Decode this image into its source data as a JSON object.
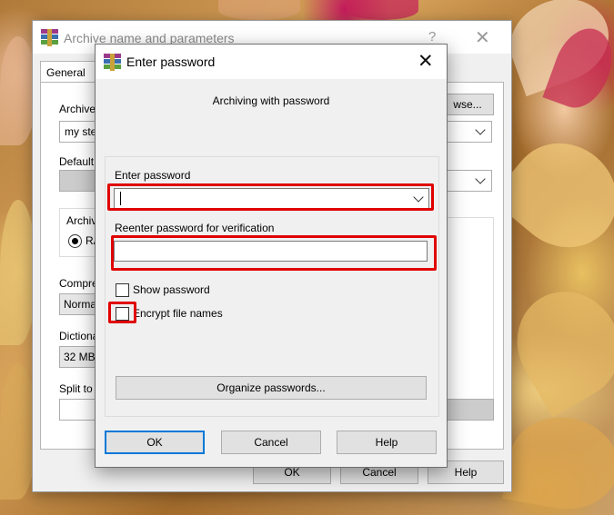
{
  "back_window": {
    "title": "Archive name and parameters",
    "help_glyph": "?",
    "close_glyph": "✕",
    "tab_general": "General",
    "archive_label_partial": "Archive",
    "archive_value_partial": "my ste",
    "browse_partial": "wse...",
    "default_label_partial": "Default",
    "archive_format_label_partial": "Archiv",
    "rar_label_partial": "RA",
    "compression_label_partial": "Compre",
    "compression_value_partial": "Norma",
    "dictionary_label_partial": "Dictiona",
    "dictionary_value_partial": "32 MB",
    "split_label_partial": "Split to",
    "ok_label": "OK",
    "cancel_label": "Cancel",
    "help_label": "Help"
  },
  "dialog": {
    "title": "Enter password",
    "close_glyph": "✕",
    "subtitle": "Archiving with password",
    "enter_password_label": "Enter password",
    "enter_password_value": "",
    "reenter_label": "Reenter password for verification",
    "reenter_value": "",
    "show_password_label": "Show password",
    "show_password_checked": false,
    "encrypt_names_label": "Encrypt file names",
    "encrypt_names_checked": false,
    "organize_label": "Organize passwords...",
    "ok_label": "OK",
    "cancel_label": "Cancel",
    "help_label": "Help"
  },
  "colors": {
    "highlight": "#e00000",
    "default_button_border": "#0078d7",
    "dialog_bg": "#f0f0f0"
  },
  "icons": {
    "app_icon": "winrar-books-icon",
    "close_icon": "close-icon",
    "dropdown_icon": "chevron-down-icon"
  }
}
